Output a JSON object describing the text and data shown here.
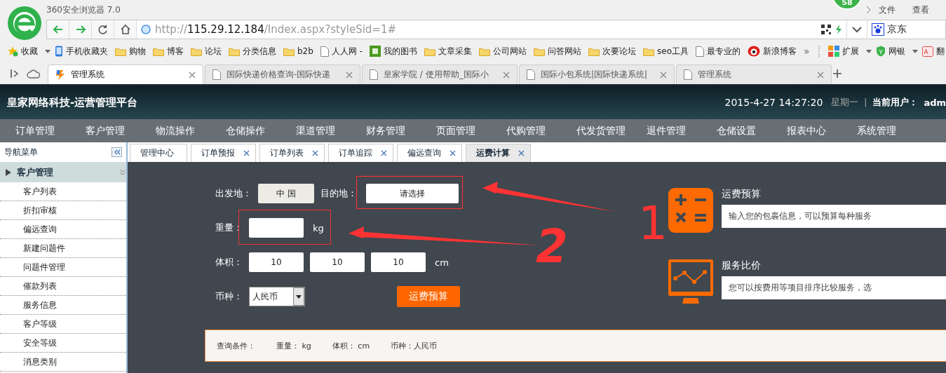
{
  "browser": {
    "title": "360安全浏览器 7.0",
    "badge": "58",
    "menu": [
      "文件",
      "查看"
    ],
    "address": {
      "scheme": "http://",
      "host": "115.29.12.184",
      "path": "/Index.aspx?styleSid=1#"
    },
    "search_engine": "京东",
    "bookmarks": [
      {
        "kind": "star",
        "label": "收藏"
      },
      {
        "kind": "phone",
        "label": "手机收藏夹"
      },
      {
        "kind": "folder",
        "label": "购物"
      },
      {
        "kind": "folder",
        "label": "博客"
      },
      {
        "kind": "folder",
        "label": "论坛"
      },
      {
        "kind": "folder",
        "label": "分类信息"
      },
      {
        "kind": "folder",
        "label": "b2b"
      },
      {
        "kind": "page",
        "label": "人人网 -"
      },
      {
        "kind": "book",
        "label": "我的图书"
      },
      {
        "kind": "folder",
        "label": "文章采集"
      },
      {
        "kind": "folder",
        "label": "公司网站"
      },
      {
        "kind": "folder",
        "label": "问答网站"
      },
      {
        "kind": "folder",
        "label": "次要论坛"
      },
      {
        "kind": "folder",
        "label": "seo工具"
      },
      {
        "kind": "page",
        "label": "最专业的"
      },
      {
        "kind": "eye",
        "label": "新浪博客"
      }
    ],
    "bookmark_more": "»",
    "extensions": [
      {
        "kind": "grid",
        "label": "扩展"
      },
      {
        "kind": "shield",
        "label": "网银"
      },
      {
        "kind": "translate",
        "label": "翻"
      }
    ],
    "tabs": [
      {
        "title": "管理系统",
        "selected": true
      },
      {
        "title": "国际快递价格查询-国际快递",
        "selected": false
      },
      {
        "title": "皇家学院 / 使用帮助_国际小",
        "selected": false
      },
      {
        "title": "国际小包系统|国际快递系统|",
        "selected": false
      },
      {
        "title": "管理系统",
        "selected": false
      }
    ]
  },
  "app": {
    "title": "皇家网络科技-运营管理平台",
    "datetime": "2015-4-27 14:27:20",
    "weekday": "星期一",
    "separator": "|",
    "user_label": "当前用户：",
    "user": "adm"
  },
  "nav_menu": [
    "订单管理",
    "客户管理",
    "物流操作",
    "仓储操作",
    "渠道管理",
    "财务管理",
    "页面管理",
    "代购管理",
    "代发货管理",
    "退件管理",
    "仓储设置",
    "报表中心",
    "系统管理"
  ],
  "nav_panel": {
    "title": "导航菜单",
    "group": {
      "label": "客户管理",
      "expanded": true,
      "items": [
        "客户列表",
        "折扣审核",
        "偏远查询",
        "新建问题件",
        "问题件管理",
        "催款列表",
        "服务信息",
        "客户等级",
        "安全等级",
        "消息类别"
      ]
    }
  },
  "page_tabs": [
    {
      "label": "管理中心",
      "selected": false,
      "closable": false
    },
    {
      "label": "订单预报",
      "selected": false,
      "closable": true
    },
    {
      "label": "订单列表",
      "selected": false,
      "closable": true
    },
    {
      "label": "订单追踪",
      "selected": false,
      "closable": true
    },
    {
      "label": "偏远查询",
      "selected": false,
      "closable": true
    },
    {
      "label": "运费计算",
      "selected": true,
      "closable": true
    }
  ],
  "form": {
    "origin_label": "出发地：",
    "origin_value": "中 国",
    "destination_label": "目的地：",
    "destination_value": "请选择",
    "weight_label": "重量：",
    "weight_unit": "kg",
    "volume_label": "体积：",
    "volume_values": [
      "10",
      "10",
      "10"
    ],
    "volume_unit": "cm",
    "currency_label": "币种：",
    "currency_value": "人民币",
    "submit": "运费预算"
  },
  "info_cards": [
    {
      "kind": "calculator",
      "title": "运费预算",
      "text": "输入您的包裹信息，可以预算每种服务"
    },
    {
      "kind": "monitor",
      "title": "服务比价",
      "text": "您可以按费用等项目排序比较服务，选"
    }
  ],
  "query_bar": {
    "label": "查询条件：",
    "items": [
      "重量： kg",
      "体积： cm",
      "币种：人民币"
    ]
  },
  "annotations": [
    "1",
    "2"
  ]
}
